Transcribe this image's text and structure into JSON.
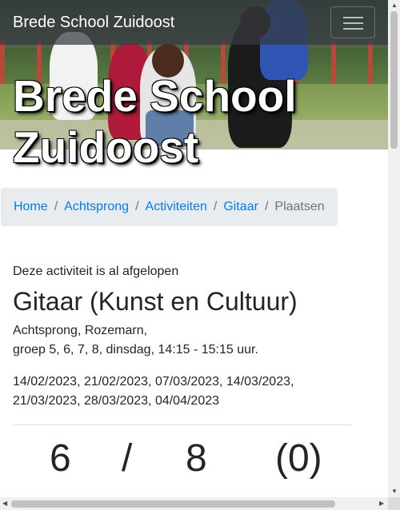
{
  "navbar": {
    "brand": "Brede School Zuidoost",
    "toggler_icon": "hamburger-menu-icon"
  },
  "hero": {
    "title": "Brede School Zuidoost"
  },
  "breadcrumb": {
    "items": [
      "Home",
      "Achtsprong",
      "Activiteiten",
      "Gitaar"
    ],
    "active": "Plaatsen",
    "separator": "/"
  },
  "activity": {
    "notice": "Deze activiteit is al afgelopen",
    "title": "Gitaar (Kunst en Cultuur)",
    "location_line1": "Achtsprong, Rozemarn,",
    "location_line2": "groep 5, 6, 7, 8, dinsdag, 14:15 - 15:15 uur.",
    "dates_line1": "14/02/2023, 21/02/2023, 07/03/2023, 14/03/2023,",
    "dates_line2": "21/03/2023, 28/03/2023, 04/04/2023"
  },
  "capacity": {
    "taken": "6",
    "separator": "/",
    "total": "8",
    "waitlist": "(0)"
  },
  "colors": {
    "link": "#007bff",
    "breadcrumb_bg": "#e9ecef",
    "navbar_bg": "#343a40",
    "text": "#212529"
  }
}
